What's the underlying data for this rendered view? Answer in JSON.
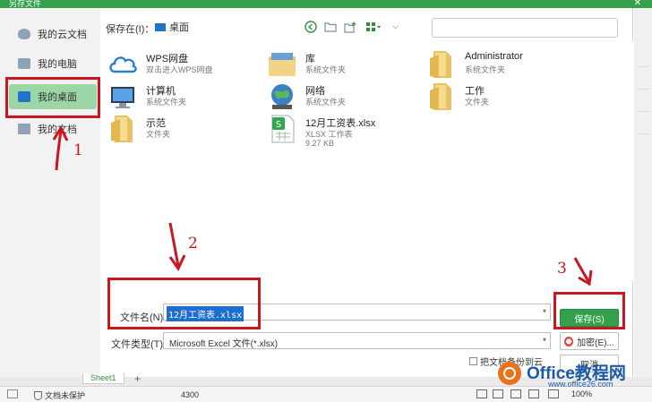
{
  "dialog": {
    "title": "另存文件",
    "save_in_label": "保存在(I)：",
    "location": "桌面",
    "filename_label": "文件名(N)：",
    "filename_value": "12月工资表.xlsx",
    "filetype_label": "文件类型(T)：",
    "filetype_value": "Microsoft Excel 文件(*.xlsx)",
    "backup_label": "把文档备份到云",
    "buttons": {
      "save": "保存(S)",
      "encrypt": "加密(E)...",
      "cancel": "取消"
    }
  },
  "sidebar": {
    "items": [
      {
        "label": "我的云文档",
        "icon": "cloud-doc-icon"
      },
      {
        "label": "我的电脑",
        "icon": "computer-icon"
      },
      {
        "label": "我的桌面",
        "icon": "desktop-icon",
        "active": true
      },
      {
        "label": "我的文档",
        "icon": "documents-icon"
      }
    ]
  },
  "files": [
    {
      "name": "WPS网盘",
      "type": "双击进入WPS网盘",
      "size": "",
      "icon": "cloud-drive-icon"
    },
    {
      "name": "库",
      "type": "系统文件夹",
      "size": "",
      "icon": "library-icon"
    },
    {
      "name": "Administrator",
      "type": "系统文件夹",
      "size": "",
      "icon": "folder-icon"
    },
    {
      "name": "计算机",
      "type": "系统文件夹",
      "size": "",
      "icon": "computer-icon"
    },
    {
      "name": "网络",
      "type": "系统文件夹",
      "size": "",
      "icon": "network-icon"
    },
    {
      "name": "工作",
      "type": "文件夹",
      "size": "",
      "icon": "folder-icon"
    },
    {
      "name": "示范",
      "type": "文件夹",
      "size": "",
      "icon": "folder-icon"
    },
    {
      "name": "12月工资表.xlsx",
      "type": "XLSX 工作表",
      "size": "9.27 KB",
      "icon": "xlsx-file-icon"
    }
  ],
  "background": {
    "sheet_tab": "Sheet1",
    "status_protect": "文档未保护",
    "status_number": "4300",
    "zoom": "100%"
  },
  "annotations": {
    "n1": "1",
    "n2": "2",
    "n3": "3"
  },
  "watermark": {
    "main": "Office教程网",
    "sub": "www.office26.com"
  },
  "colors": {
    "accent": "#33a14b",
    "selection": "#1e6dd0",
    "annotation": "#c8171e",
    "sidebar_active": "#9cd6a6"
  }
}
